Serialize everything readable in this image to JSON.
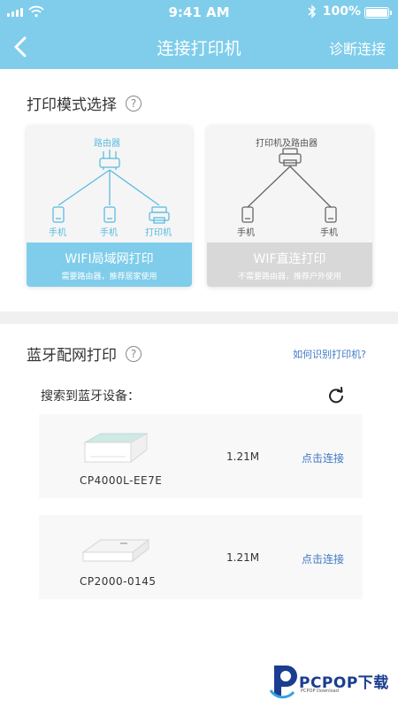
{
  "status_bar": {
    "time": "9:41 AM",
    "battery": "100%",
    "battery_level": 1.0
  },
  "nav": {
    "title": "连接打印机",
    "right_action": "诊断连接"
  },
  "print_mode": {
    "title": "打印模式选择",
    "help": "?",
    "options": [
      {
        "label": "WIFI局域网打印",
        "sub": "需要路由器，推荐居家使用",
        "selected": true,
        "diagram": {
          "top": "路由器",
          "nodes": [
            "手机",
            "手机",
            "打印机"
          ]
        }
      },
      {
        "label": "WIF直连打印",
        "sub": "不需要路由器，推荐户外使用",
        "selected": false,
        "diagram": {
          "top": "打印机及路由器",
          "nodes": [
            "手机",
            "手机"
          ]
        }
      }
    ]
  },
  "bluetooth": {
    "title": "蓝牙配网打印",
    "help": "?",
    "help_link": "如何识别打印机?",
    "search_label": "搜索到蓝牙设备：",
    "devices": [
      {
        "model": "CP4000L-EE7E",
        "size": "1.21M",
        "action": "点击连接"
      },
      {
        "model": "CP2000-0145",
        "size": "1.21M",
        "action": "点击连接"
      }
    ]
  },
  "watermark": {
    "brand": "PCPOP下载",
    "sub": "PCPOP Download"
  },
  "colors": {
    "accent": "#7fcdea",
    "link": "#3f78c6",
    "inactive": "#d8d8d8"
  }
}
